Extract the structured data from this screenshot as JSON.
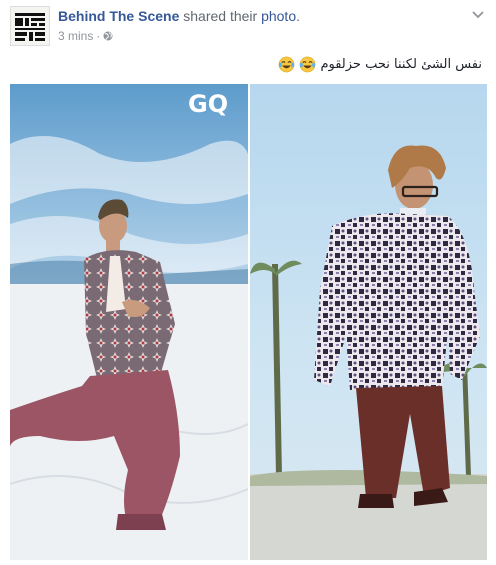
{
  "post": {
    "page_name": "Behind The Scene",
    "shared_text": "shared their",
    "photo_link": "photo",
    "timestamp": "3 mins",
    "separator": "·",
    "privacy_icon": "globe-icon",
    "options_icon": "chevron-down-icon",
    "caption": "نفس الشئ لكننا نحب حزلقوم",
    "caption_emojis": [
      "laughing-tears-emoji",
      "laughing-tears-emoji"
    ]
  },
  "photo": {
    "magazine_logo": "GQ",
    "left_panel": "man kneeling on white sand wearing patterned shirt and mauve trousers",
    "right_panel": "man with curly hair and glasses wearing patterned shirt and brown trousers"
  },
  "colors": {
    "link_blue": "#365899",
    "meta_gray": "#90949c",
    "sky_blue": "#8fbfe3"
  }
}
